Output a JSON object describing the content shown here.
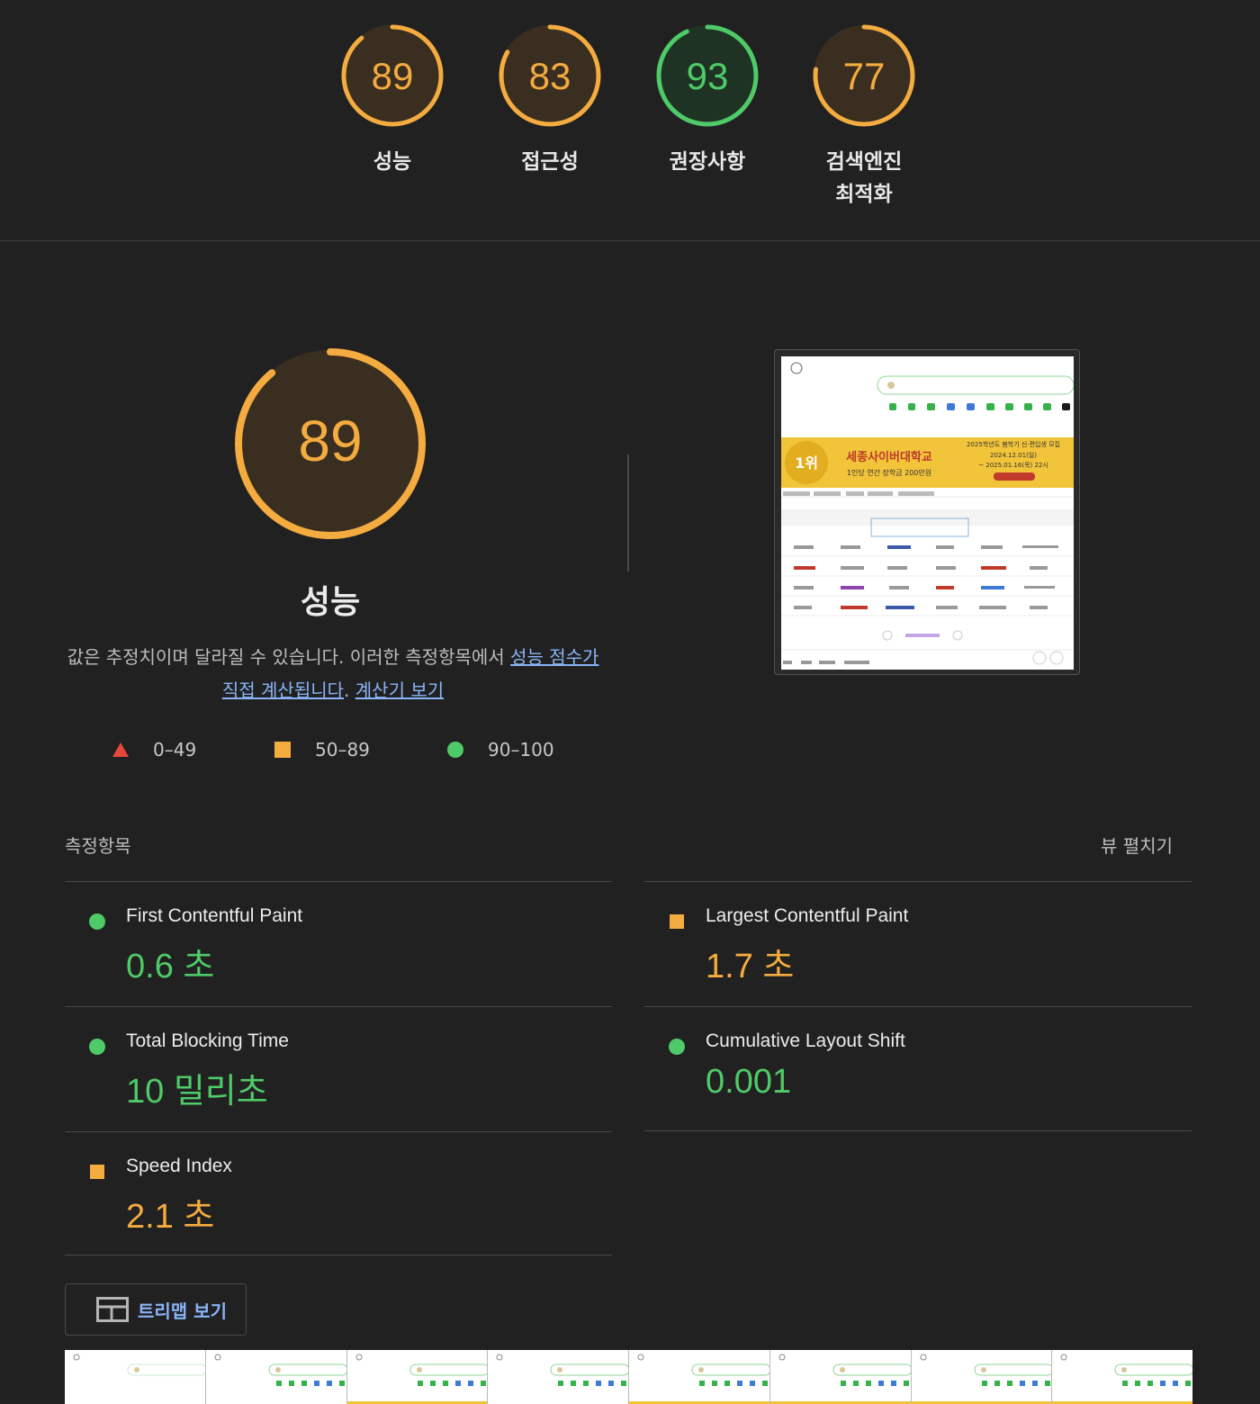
{
  "summary": {
    "gauges": [
      {
        "score": "89",
        "label": "성능",
        "color": "#f4ab3f",
        "fraction": 0.89
      },
      {
        "score": "83",
        "label": "접근성",
        "color": "#f4ab3f",
        "fraction": 0.83
      },
      {
        "score": "93",
        "label": "권장사항",
        "color": "#4fca68",
        "fraction": 0.93
      },
      {
        "score": "77",
        "label": "검색엔진",
        "label2": "최적화",
        "color": "#f4ab3f",
        "fraction": 0.77
      }
    ]
  },
  "performance": {
    "score": "89",
    "fraction": 0.89,
    "title": "성능",
    "desc_before": "값은 추정치이며 달라질 수 있습니다. 이러한 측정항목에서 ",
    "desc_link1": "성능 점수가 직접 계산됩니다",
    "desc_mid": ". ",
    "desc_link2": "계산기 보기",
    "legend": {
      "fail": "0–49",
      "average": "50–89",
      "pass": "90–100"
    }
  },
  "metrics": {
    "heading": "측정항목",
    "expand_label": "뷰 펼치기",
    "items": [
      {
        "name": "First Contentful Paint",
        "value": "0.6 초",
        "status": "pass"
      },
      {
        "name": "Largest Contentful Paint",
        "value": "1.7 초",
        "status": "average"
      },
      {
        "name": "Total Blocking Time",
        "value": "10 밀리초",
        "status": "pass"
      },
      {
        "name": "Cumulative Layout Shift",
        "value": "0.001",
        "status": "pass"
      },
      {
        "name": "Speed Index",
        "value": "2.1 초",
        "status": "average"
      }
    ]
  },
  "treemap_label": "트리맵 보기",
  "colors": {
    "pass": "#4fca68",
    "average": "#f4ab3f",
    "fail": "#e5483b",
    "link": "#8ab4f8"
  },
  "thumbnail": {
    "banner_rank": "1위",
    "banner_title": "세종사이버대학교",
    "banner_sub": "1인당 연간 장학금 200만원",
    "banner_right": "2025학년도 봄학기 신·편입생 모집",
    "banner_date1": "2024.12.01(일)",
    "banner_date2": "~ 2025.01.16(목) 22시"
  }
}
